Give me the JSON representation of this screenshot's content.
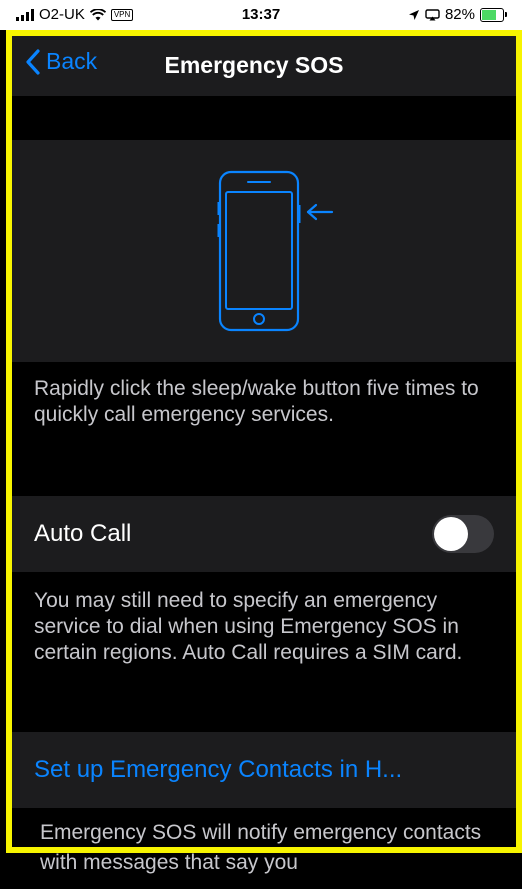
{
  "status_bar": {
    "carrier": "O2-UK",
    "vpn_label": "VPN",
    "time": "13:37",
    "battery": "82%",
    "battery_level": 0.82,
    "icons": [
      "signal-icon",
      "wifi-icon",
      "location-arrow-icon",
      "screen-mirroring-icon",
      "battery-charging-icon"
    ]
  },
  "nav": {
    "back_label": "Back",
    "title": "Emergency SOS"
  },
  "illustration": {
    "name": "phone-side-button-illustration",
    "accent_color": "#0a84ff"
  },
  "sos_description": "Rapidly click the sleep/wake button five times to quickly call emergency services.",
  "auto_call": {
    "label": "Auto Call",
    "enabled": false,
    "footer": "You may still need to specify an emergency service to dial when using Emergency SOS in certain regions. Auto Call requires a SIM card."
  },
  "contacts_link": "Set up Emergency Contacts in H...",
  "bottom_text": "Emergency SOS will notify emergency contacts with messages that say you",
  "colors": {
    "highlight_frame": "#f7f400",
    "link": "#0a84ff",
    "background": "#000000",
    "cell": "#1c1c1e"
  }
}
